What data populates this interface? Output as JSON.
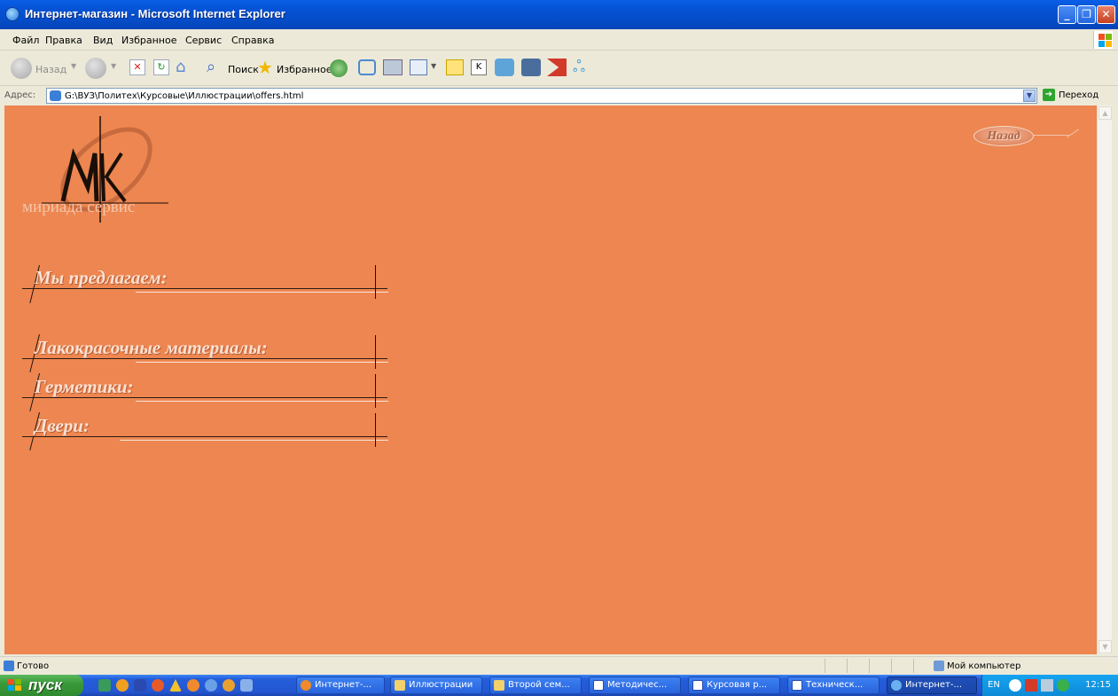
{
  "window": {
    "title": "Интернет-магазин - Microsoft Internet Explorer"
  },
  "menu": [
    "Файл",
    "Правка",
    "Вид",
    "Избранное",
    "Сервис",
    "Справка"
  ],
  "toolbar": {
    "back_label": "Назад",
    "search_label": "Поиск",
    "favorites_label": "Избранное"
  },
  "address": {
    "label": "Адрес:",
    "url": "G:\\ВУЗ\\Политех\\Курсовые\\Иллюстрации\\offers.html",
    "go_label": "Переход"
  },
  "page": {
    "logo_text": "мириада сервис",
    "back_button": "Назад",
    "intro_heading": "Мы предлагаем:",
    "categories": [
      "Лакокрасочные материалы:",
      "Герметики:",
      "Двери:"
    ]
  },
  "status": {
    "text": "Готово",
    "zone": "Мой компьютер"
  },
  "taskbar": {
    "start_label": "пуск",
    "tasks": [
      "Интернет-...",
      "Иллюстрации",
      "Второй сем...",
      "Методичес...",
      "Курсовая р...",
      "Техническ...",
      "Интернет-..."
    ],
    "lang": "EN",
    "clock": "12:15"
  }
}
